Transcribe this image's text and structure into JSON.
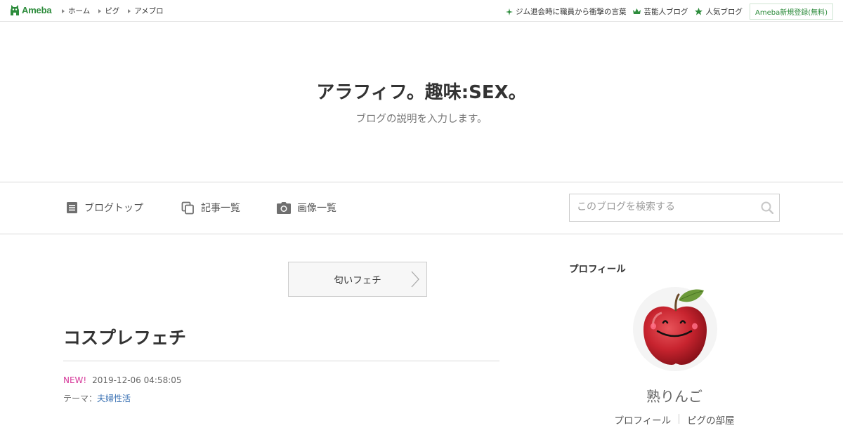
{
  "topbar": {
    "logo_text": "Ameba",
    "nav": [
      {
        "label": "ホーム"
      },
      {
        "label": "ピグ"
      },
      {
        "label": "アメブロ"
      }
    ],
    "right_links": [
      {
        "label": "ジム退会時に職員から衝撃の言葉",
        "icon": "sparkle-icon"
      },
      {
        "label": "芸能人ブログ",
        "icon": "crown-icon"
      },
      {
        "label": "人気ブログ",
        "icon": "star-icon"
      }
    ],
    "register_label": "Ameba新規登録(無料)"
  },
  "hero": {
    "title": "アラフィフ。趣味:SEX。",
    "description": "ブログの説明を入力します。"
  },
  "blog_nav": {
    "items": [
      {
        "label": "ブログトップ",
        "icon": "document-icon"
      },
      {
        "label": "記事一覧",
        "icon": "copy-icon"
      },
      {
        "label": "画像一覧",
        "icon": "camera-icon"
      }
    ],
    "search_placeholder": "このブログを検索する"
  },
  "main": {
    "theme_button": "匂いフェチ",
    "entry": {
      "title": "コスプレフェチ",
      "new_label": "NEW!",
      "datetime": "2019-12-06 04:58:05",
      "theme_prefix": "テーマ：",
      "theme_link": "夫婦性活"
    }
  },
  "sidebar": {
    "heading": "プロフィール",
    "name": "熟りんご",
    "links": [
      {
        "label": "プロフィール"
      },
      {
        "label": "ピグの部屋"
      }
    ]
  },
  "colors": {
    "brand_green": "#2d8c3c",
    "new_badge": "#d6399a",
    "link_blue": "#3b72b4"
  }
}
